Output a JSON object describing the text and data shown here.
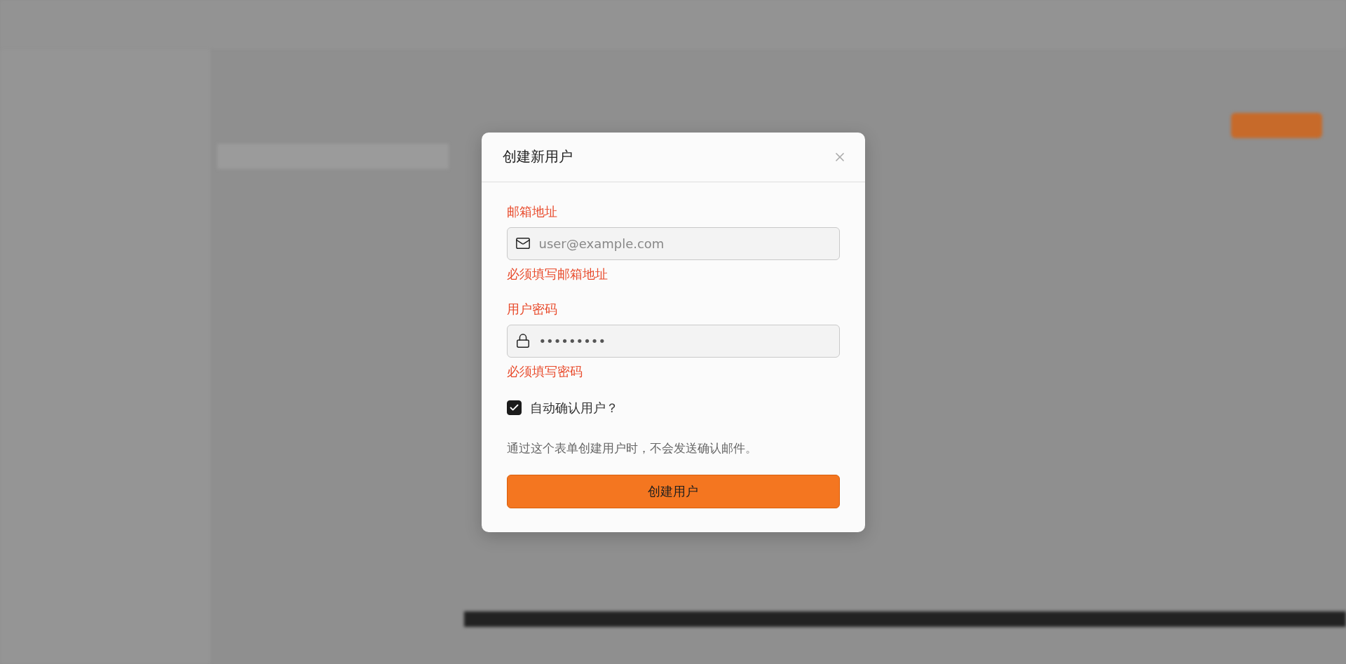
{
  "dialog": {
    "title": "创建新用户",
    "fields": [
      {
        "kind": "email",
        "label": "邮箱地址",
        "placeholder": "user@example.com",
        "error": "必须填写邮箱地址"
      },
      {
        "kind": "password",
        "label": "用户密码",
        "value": "•••••••••",
        "error": "必须填写密码"
      }
    ],
    "auto_confirm": {
      "label": "自动确认用户？",
      "checked": true
    },
    "note": "通过这个表单创建用户时，不会发送确认邮件。",
    "submit": "创建用户"
  }
}
